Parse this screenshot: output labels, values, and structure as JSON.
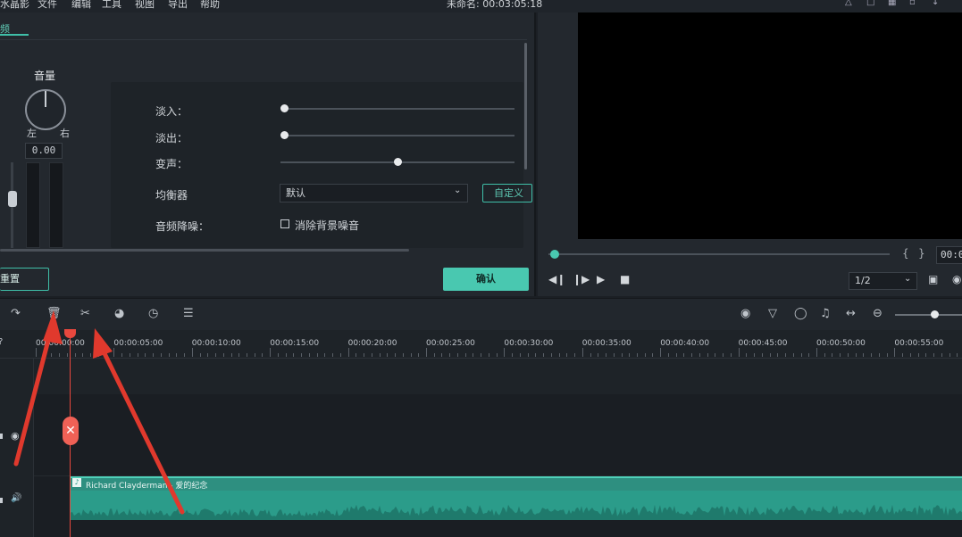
{
  "menubar": {
    "items": [
      "水晶影",
      "文件",
      "编辑",
      "工具",
      "视图",
      "导出",
      "帮助"
    ],
    "project_name": "未命名: 00:03:05:18"
  },
  "edit_panel": {
    "tab_label": "频",
    "volume": {
      "label": "音量",
      "left_label": "左",
      "right_label": "右",
      "value": "0.00"
    },
    "settings": {
      "fade_in_label": "淡入：",
      "fade_in_level": 0,
      "fade_out_label": "淡出：",
      "fade_out_level": 0,
      "pitch_label": "变声：",
      "pitch_level": 0.5,
      "equalizer_label": "均衡器",
      "equalizer_value": "默认",
      "equalizer_custom_label": "自定义",
      "denoise_label": "音频降噪：",
      "denoise_option_label": "消除背景噪音",
      "denoise_checked": false
    },
    "reset_label": "重置",
    "confirm_label": "确认"
  },
  "preview": {
    "mark_in": "{",
    "mark_out": "}",
    "time": "00:0",
    "quality": "1/2"
  },
  "timeline": {
    "ruler_labels": [
      "00:00:00:00",
      "00:00:05:00",
      "00:00:10:00",
      "00:00:15:00",
      "00:00:20:00",
      "00:00:25:00",
      "00:00:30:00",
      "00:00:35:00",
      "00:00:40:00",
      "00:00:45:00",
      "00:00:50:00",
      "00:00:55:00"
    ],
    "audio_clip_title": "Richard Clayderman - 爱的纪念"
  },
  "colors": {
    "accent": "#49c8b0",
    "playhead": "#e8483e",
    "audio_clip": "#2b9c8a",
    "annotation_arrow": "#e0392d"
  }
}
